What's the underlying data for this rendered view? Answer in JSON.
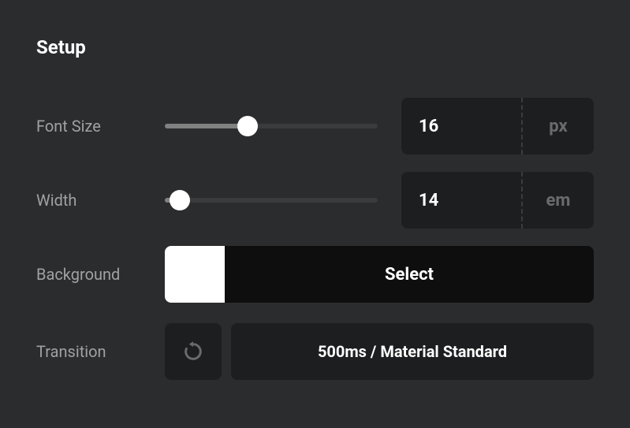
{
  "title": "Setup",
  "fontSize": {
    "label": "Font Size",
    "value": "16",
    "unit": "px",
    "sliderPercent": 39
  },
  "width": {
    "label": "Width",
    "value": "14",
    "unit": "em",
    "sliderPercent": 7
  },
  "background": {
    "label": "Background",
    "swatchColor": "#ffffff",
    "buttonLabel": "Select"
  },
  "transition": {
    "label": "Transition",
    "value": "500ms / Material Standard"
  }
}
